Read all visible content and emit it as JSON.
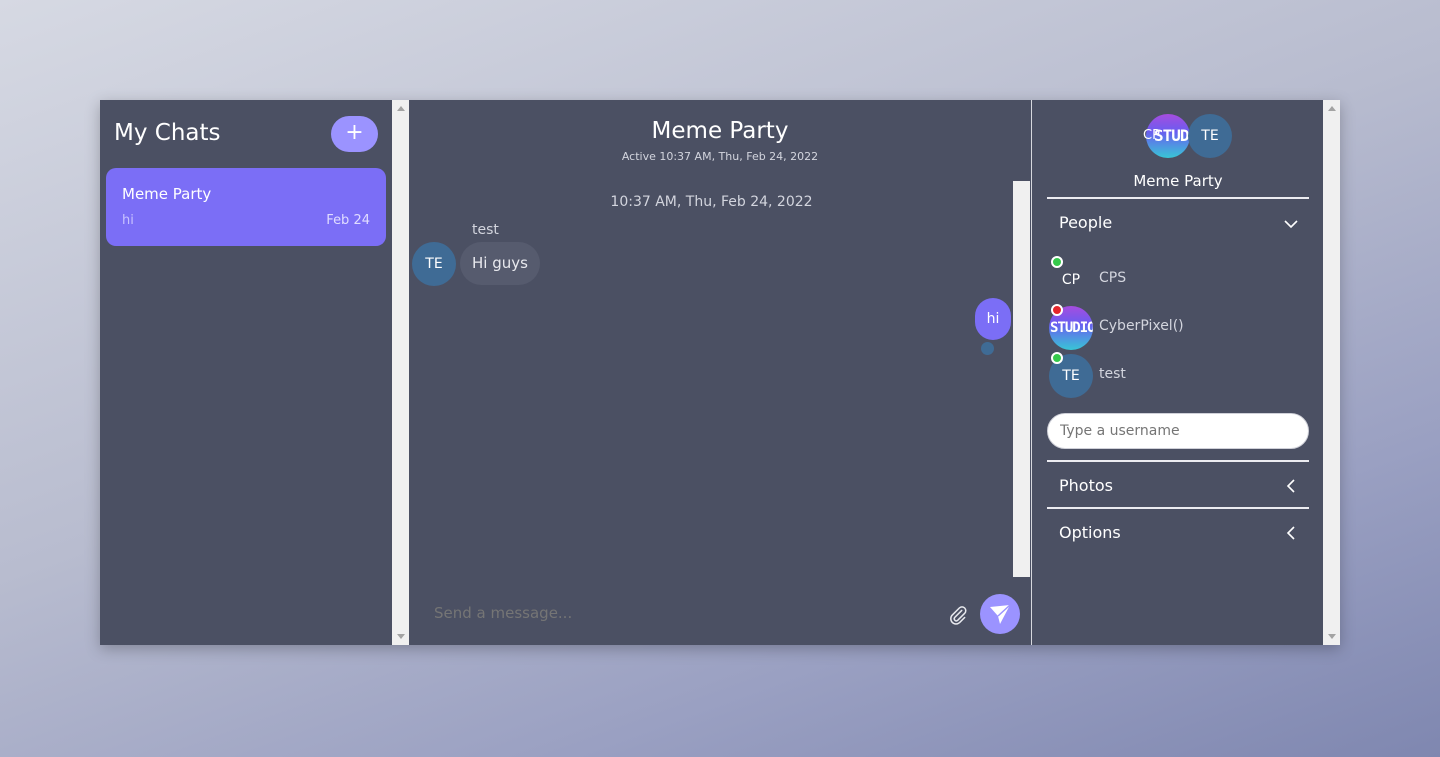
{
  "sidebar": {
    "title": "My Chats",
    "add_label": "+",
    "chats": [
      {
        "name": "Meme Party",
        "last_message": "hi",
        "date": "Feb 24"
      }
    ]
  },
  "chat": {
    "title": "Meme Party",
    "subtitle": "Active 10:37 AM, Thu, Feb 24, 2022",
    "date_separator": "10:37 AM, Thu, Feb 24, 2022",
    "messages": [
      {
        "sender": "test",
        "avatar": "TE",
        "text": "Hi guys",
        "direction": "incoming"
      },
      {
        "text": "hi",
        "direction": "outgoing"
      }
    ],
    "composer_placeholder": "Send a message..."
  },
  "details": {
    "avatars": [
      "CP",
      "TE"
    ],
    "name": "Meme Party",
    "people_label": "People",
    "people": [
      {
        "initials": "CP",
        "name": "CPS",
        "status": "online"
      },
      {
        "initials": "STUDIO",
        "name": "CyberPixel()",
        "status": "offline"
      },
      {
        "initials": "TE",
        "name": "test",
        "status": "online"
      }
    ],
    "username_placeholder": "Type a username",
    "photos_label": "Photos",
    "options_label": "Options"
  },
  "colors": {
    "accent": "#7b6ef6",
    "accent_light": "#9b93ff",
    "panel": "#4b5063",
    "avatar": "#3f6b95",
    "online": "#35c94b",
    "offline": "#e5262c"
  }
}
